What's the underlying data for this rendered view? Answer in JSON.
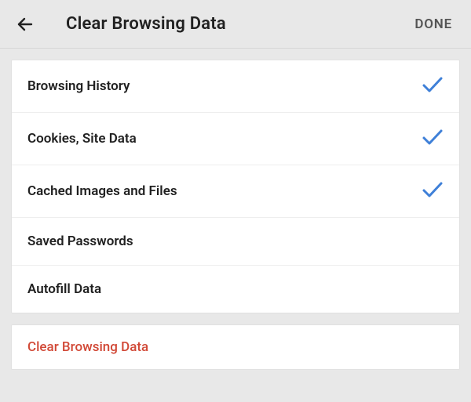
{
  "header": {
    "title": "Clear Browsing Data",
    "done_label": "DONE"
  },
  "options": [
    {
      "label": "Browsing History",
      "checked": true
    },
    {
      "label": "Cookies, Site Data",
      "checked": true
    },
    {
      "label": "Cached Images and Files",
      "checked": true
    },
    {
      "label": "Saved Passwords",
      "checked": false
    },
    {
      "label": "Autofill Data",
      "checked": false
    }
  ],
  "action": {
    "label": "Clear Browsing Data"
  },
  "colors": {
    "accent": "#3f80d8",
    "danger": "#d14836"
  }
}
